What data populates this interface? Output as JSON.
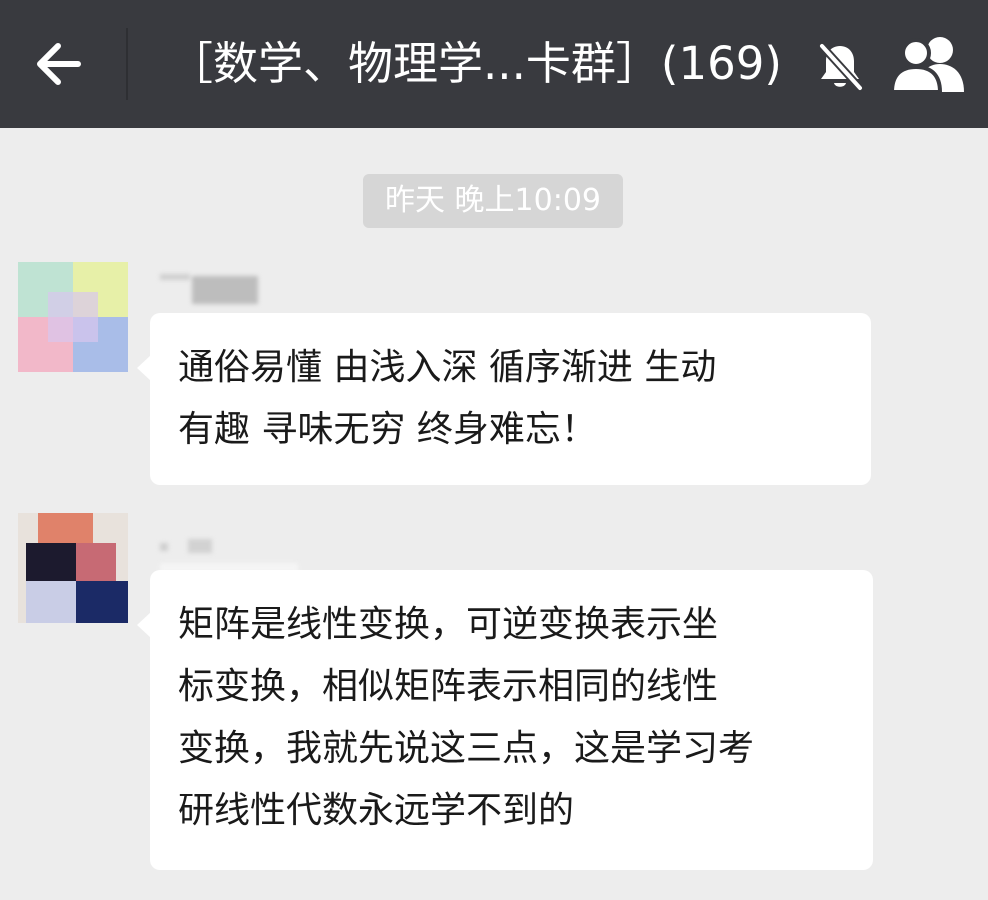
{
  "header": {
    "title": "［数学、物理学...卡群］(169)",
    "back_icon": "arrow-left-icon",
    "mute_icon": "bell-off-icon",
    "members_icon": "group-members-icon"
  },
  "timestamp": "昨天 晚上10:09",
  "messages": [
    {
      "lines": [
        "通俗易懂 由浅入深 循序渐进 生动",
        "有趣 寻味无穷 终身难忘！"
      ]
    },
    {
      "lines": [
        "矩阵是线性变换，可逆变换表示坐",
        "标变换，相似矩阵表示相同的线性",
        "变换，我就先说这三点，这是学习考",
        "研线性代数永远学不到的"
      ]
    }
  ],
  "colors": {
    "header_bg": "#393a3f",
    "chat_bg": "#ededed",
    "bubble_bg": "#ffffff",
    "time_pill_bg": "#d6d6d6"
  }
}
